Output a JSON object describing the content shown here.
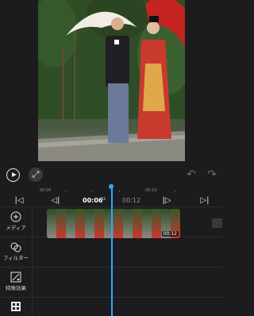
{
  "ruler": {
    "t0": "00:00",
    "t1": "00:10"
  },
  "transport": {
    "current": "00:06",
    "current_frac": "15",
    "total": "00:12"
  },
  "tools": [
    {
      "label": "メディア",
      "icon": "add-circle-icon"
    },
    {
      "label": "フィルター",
      "icon": "filter-icon"
    },
    {
      "label": "特殊効果",
      "icon": "effects-icon"
    },
    {
      "label": "",
      "icon": "grid-icon"
    }
  ],
  "clip": {
    "duration": "00:12"
  },
  "colors": {
    "accent": "#2ea6ff",
    "background": "#1c1c1e",
    "track": "#2c2c2e"
  }
}
